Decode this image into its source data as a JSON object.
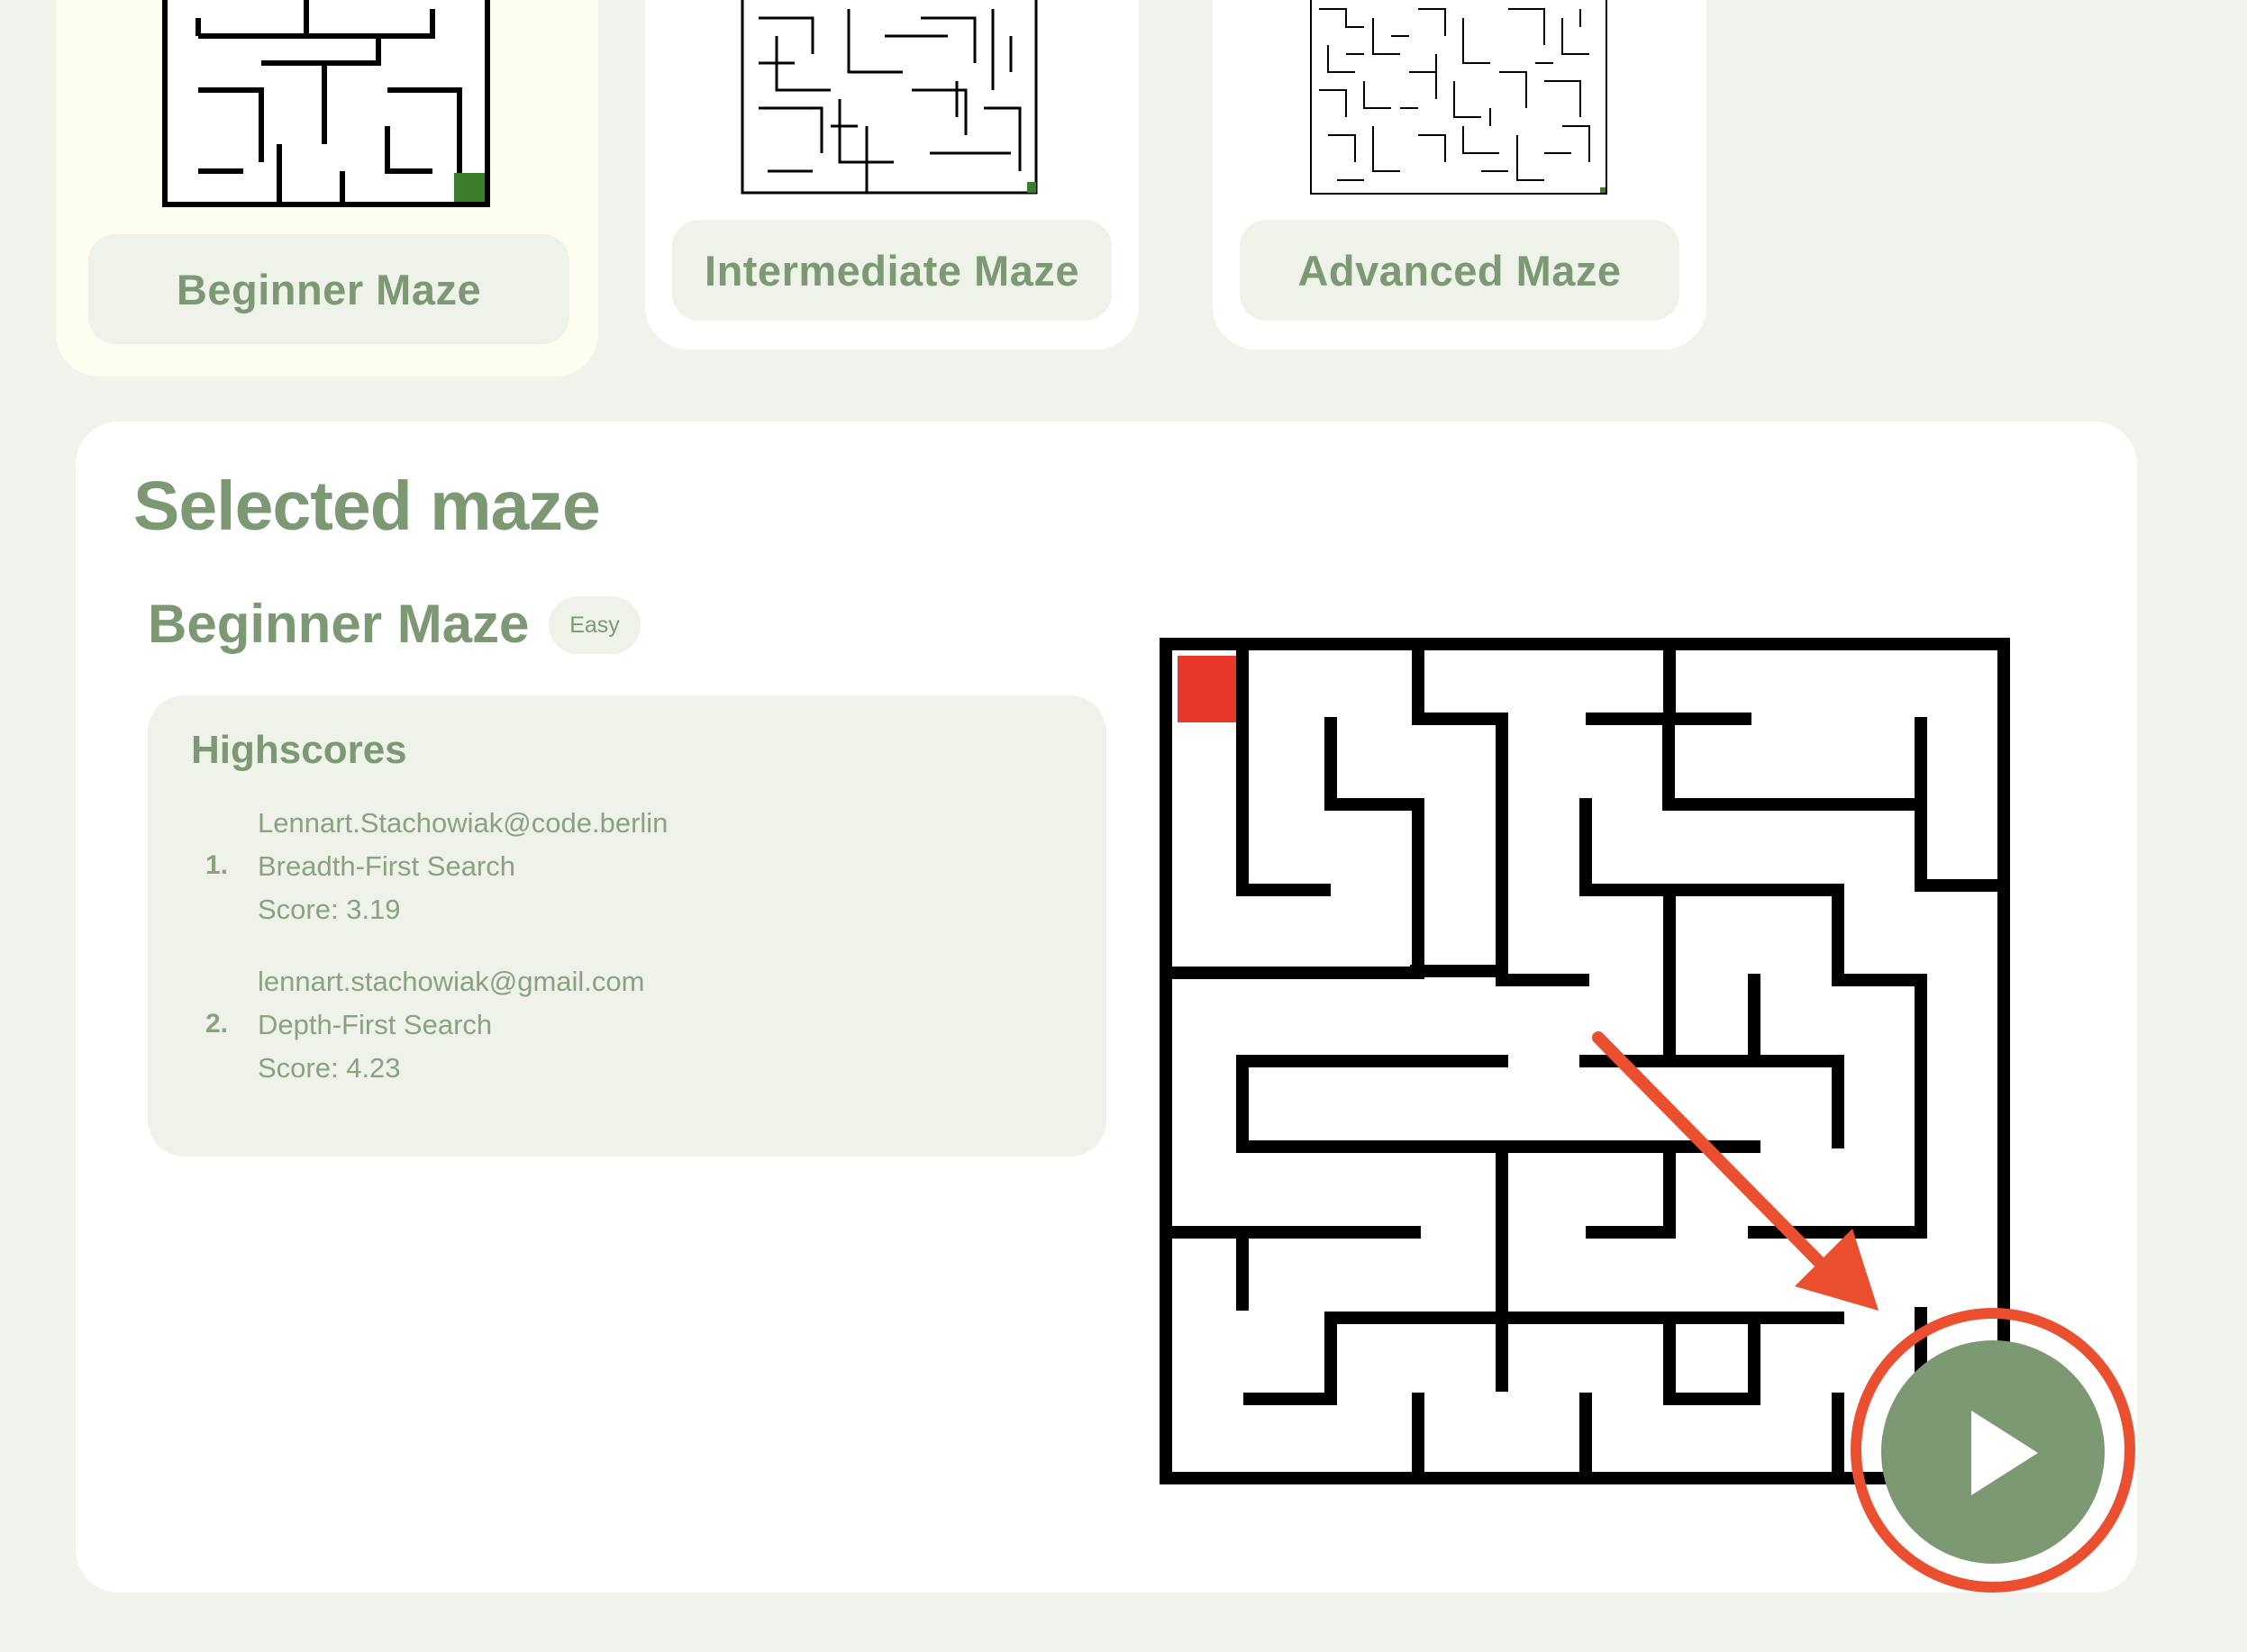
{
  "maze_options": [
    {
      "label": "Beginner Maze",
      "selected": true
    },
    {
      "label": "Intermediate Maze",
      "selected": false
    },
    {
      "label": "Advanced Maze",
      "selected": false
    }
  ],
  "panel": {
    "heading": "Selected maze",
    "maze_name": "Beginner Maze",
    "difficulty": "Easy"
  },
  "highscores": {
    "title": "Highscores",
    "entries": [
      {
        "rank": "1.",
        "user": "Lennart.Stachowiak@code.berlin",
        "algorithm": "Breadth-First Search",
        "score": "Score: 3.19"
      },
      {
        "rank": "2.",
        "user": "lennart.stachowiak@gmail.com",
        "algorithm": "Depth-First Search",
        "score": "Score: 4.23"
      }
    ]
  },
  "colors": {
    "accent": "#7c9973",
    "start_cell": "#e8382a",
    "goal_cell": "#3a7d2a",
    "annotation": "#ea4f2f"
  },
  "icons": {
    "play": "play-icon",
    "annotation_arrow": "arrow-icon"
  }
}
